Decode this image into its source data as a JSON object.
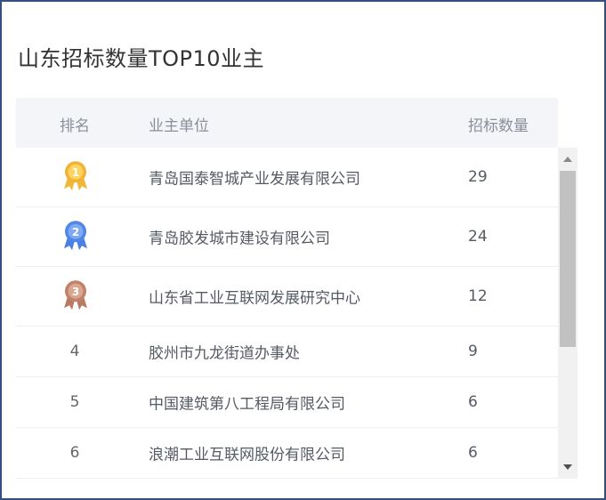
{
  "card": {
    "title": "山东招标数量TOP10业主"
  },
  "table": {
    "headers": {
      "rank": "排名",
      "owner": "业主单位",
      "count": "招标数量"
    },
    "rows": [
      {
        "rank": "1",
        "medal": "gold-medal-icon",
        "owner": "青岛国泰智城产业发展有限公司",
        "count": "29"
      },
      {
        "rank": "2",
        "medal": "silver-medal-icon",
        "owner": "青岛胶发城市建设有限公司",
        "count": "24"
      },
      {
        "rank": "3",
        "medal": "bronze-medal-icon",
        "owner": "山东省工业互联网发展研究中心",
        "count": "12"
      },
      {
        "rank": "4",
        "owner": "胶州市九龙街道办事处",
        "count": "9"
      },
      {
        "rank": "5",
        "owner": "中国建筑第八工程局有限公司",
        "count": "6"
      },
      {
        "rank": "6",
        "owner": "浪潮工业互联网股份有限公司",
        "count": "6"
      }
    ]
  },
  "colors": {
    "border": "#33507f",
    "header_bg": "#f3f5f8",
    "gold": "#f2b23a",
    "silver": "#4f86e8",
    "bronze": "#c0826a"
  },
  "scrollbar": {
    "position_fraction": 0.0
  }
}
